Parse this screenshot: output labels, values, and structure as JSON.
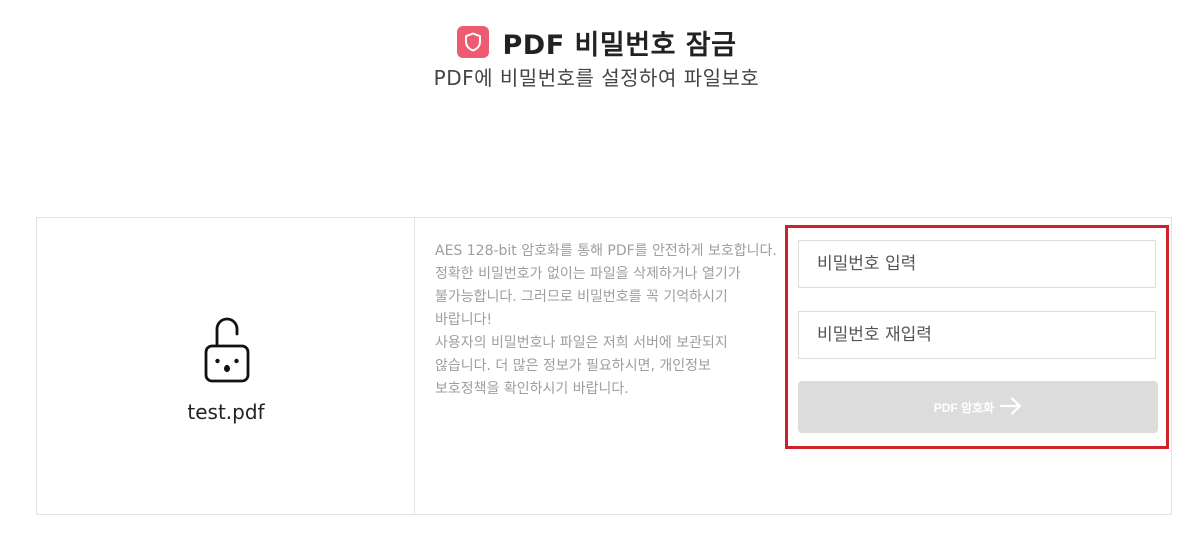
{
  "header": {
    "title": "PDF 비밀번호 잠금",
    "subtitle": "PDF에 비밀번호를 설정하여 파일보호",
    "accent_color": "#ee5a6f",
    "icon": "shield-icon"
  },
  "file": {
    "name": "test.pdf",
    "icon": "unlocked-padlock-icon"
  },
  "info": {
    "paragraph1": "AES 128-bit 암호화를 통해 PDF를 안전하게 보호합니다. 정확한 비밀번호가 없이는 파일을 삭제하거나 열기가 불가능합니다. 그러므로 비밀번호를 꼭 기억하시기 바랍니다!",
    "paragraph2": "사용자의 비밀번호나 파일은 저희 서버에 보관되지 않습니다. 더 많은 정보가 필요하시면, 개인정보 보호정책을 확인하시기 바랍니다."
  },
  "form": {
    "password_placeholder": "비밀번호 입력",
    "password_value": "",
    "confirm_placeholder": "비밀번호 재입력",
    "confirm_value": "",
    "submit_label": "PDF 암호화",
    "submit_icon": "arrow-right-icon",
    "highlight_color": "#cc2229"
  }
}
